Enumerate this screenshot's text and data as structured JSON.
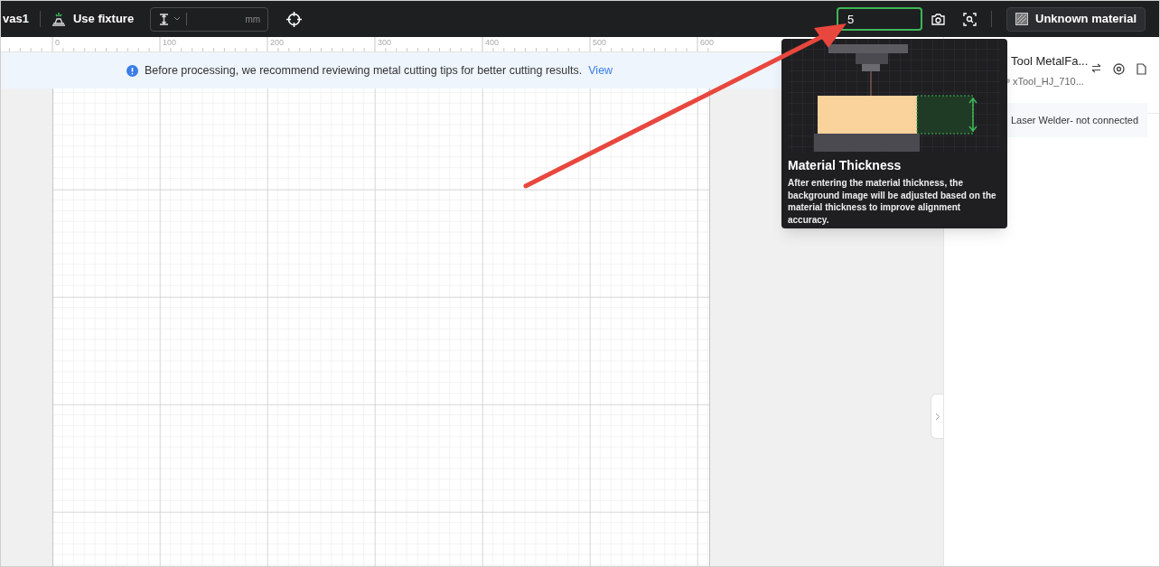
{
  "toolbar": {
    "canvas_name": "vas1",
    "fixture_button": "Use fixture",
    "thickness_unit": "mm",
    "thickness_input": {
      "value": "5",
      "focused": true
    },
    "material_button": "Unknown material"
  },
  "ruler": {
    "labels": [
      "0",
      "100",
      "200",
      "300",
      "400",
      "500",
      "600"
    ]
  },
  "banner": {
    "message": "Before processing, we recommend reviewing metal cutting tips for better cutting results.",
    "link": "View"
  },
  "device_panel": {
    "project": "Tool MetalFa...",
    "device": "xTool_HJ_710...",
    "status": "Laser Welder- not connected"
  },
  "tooltip": {
    "title": "Material Thickness",
    "body": "After entering the material thickness, the background image will be adjusted based on the material thickness to improve alignment accuracy."
  }
}
